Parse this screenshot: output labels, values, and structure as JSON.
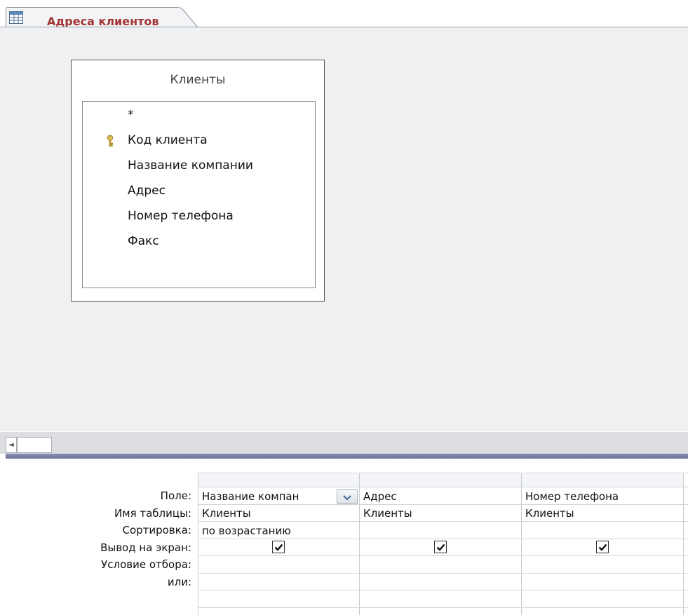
{
  "document_tab": {
    "title": "Адреса клиентов",
    "icon": "query-icon"
  },
  "table": {
    "title": "Клиенты",
    "fields": [
      "*",
      "Код клиента",
      "Название компании",
      "Адрес",
      "Номер телефона",
      "Факс"
    ],
    "primary_key_field": "Код клиента"
  },
  "grid": {
    "row_labels": [
      "Поле:",
      "Имя таблицы:",
      "Сортировка:",
      "Вывод на экран:",
      "Условие отбора:",
      "или:"
    ],
    "columns": [
      {
        "field": "Название компан",
        "table": "Клиенты",
        "sort": "по возрастанию",
        "show": true
      },
      {
        "field": "Адрес",
        "table": "Клиенты",
        "sort": "",
        "show": true
      },
      {
        "field": "Номер телефона",
        "table": "Клиенты",
        "sort": "",
        "show": true
      }
    ]
  },
  "colors": {
    "tab_title": "#a23434",
    "design_background": "#eef0f2",
    "splitter": "#7a7fa8"
  }
}
